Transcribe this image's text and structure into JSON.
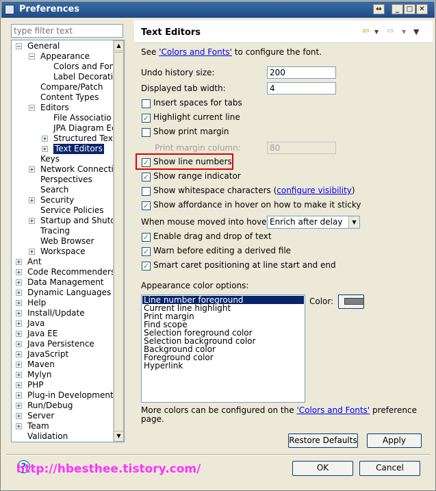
{
  "window": {
    "title": "Preferences"
  },
  "filter": {
    "placeholder": "type filter text"
  },
  "tree": [
    {
      "label": "General",
      "level": 0,
      "toggle": "−"
    },
    {
      "label": "Appearance",
      "level": 1,
      "toggle": "−"
    },
    {
      "label": "Colors and Font",
      "level": 2,
      "toggle": ""
    },
    {
      "label": "Label Decoratio",
      "level": 2,
      "toggle": ""
    },
    {
      "label": "Compare/Patch",
      "level": 1,
      "toggle": ""
    },
    {
      "label": "Content Types",
      "level": 1,
      "toggle": ""
    },
    {
      "label": "Editors",
      "level": 1,
      "toggle": "−"
    },
    {
      "label": "File Associatio",
      "level": 2,
      "toggle": ""
    },
    {
      "label": "JPA Diagram Ec",
      "level": 2,
      "toggle": ""
    },
    {
      "label": "Structured Text",
      "level": 2,
      "toggle": "+"
    },
    {
      "label": "Text Editors",
      "level": 2,
      "toggle": "+",
      "selected": true
    },
    {
      "label": "Keys",
      "level": 1,
      "toggle": ""
    },
    {
      "label": "Network Connectio",
      "level": 1,
      "toggle": "+"
    },
    {
      "label": "Perspectives",
      "level": 1,
      "toggle": ""
    },
    {
      "label": "Search",
      "level": 1,
      "toggle": ""
    },
    {
      "label": "Security",
      "level": 1,
      "toggle": "+"
    },
    {
      "label": "Service Policies",
      "level": 1,
      "toggle": ""
    },
    {
      "label": "Startup and Shutdo",
      "level": 1,
      "toggle": "+"
    },
    {
      "label": "Tracing",
      "level": 1,
      "toggle": ""
    },
    {
      "label": "Web Browser",
      "level": 1,
      "toggle": ""
    },
    {
      "label": "Workspace",
      "level": 1,
      "toggle": "+"
    },
    {
      "label": "Ant",
      "level": 0,
      "toggle": "+"
    },
    {
      "label": "Code Recommenders",
      "level": 0,
      "toggle": "+"
    },
    {
      "label": "Data Management",
      "level": 0,
      "toggle": "+"
    },
    {
      "label": "Dynamic Languages",
      "level": 0,
      "toggle": "+"
    },
    {
      "label": "Help",
      "level": 0,
      "toggle": "+"
    },
    {
      "label": "Install/Update",
      "level": 0,
      "toggle": "+"
    },
    {
      "label": "Java",
      "level": 0,
      "toggle": "+"
    },
    {
      "label": "Java EE",
      "level": 0,
      "toggle": "+"
    },
    {
      "label": "Java Persistence",
      "level": 0,
      "toggle": "+"
    },
    {
      "label": "JavaScript",
      "level": 0,
      "toggle": "+"
    },
    {
      "label": "Maven",
      "level": 0,
      "toggle": "+"
    },
    {
      "label": "Mylyn",
      "level": 0,
      "toggle": "+"
    },
    {
      "label": "PHP",
      "level": 0,
      "toggle": "+"
    },
    {
      "label": "Plug-in Development",
      "level": 0,
      "toggle": "+"
    },
    {
      "label": "Run/Debug",
      "level": 0,
      "toggle": "+"
    },
    {
      "label": "Server",
      "level": 0,
      "toggle": "+"
    },
    {
      "label": "Team",
      "level": 0,
      "toggle": "+"
    },
    {
      "label": "Validation",
      "level": 0,
      "toggle": ""
    }
  ],
  "page": {
    "title": "Text Editors",
    "see_prefix": "See ",
    "see_link": "'Colors and Fonts'",
    "see_suffix": " to configure the font.",
    "undo_label": "Undo history size:",
    "undo_value": "200",
    "tab_label": "Displayed tab width:",
    "tab_value": "4",
    "checkboxes": [
      {
        "label": "Insert spaces for tabs",
        "checked": false
      },
      {
        "label": "Highlight current line",
        "checked": true
      },
      {
        "label": "Show print margin",
        "checked": false
      }
    ],
    "print_margin_label": "Print margin column:",
    "print_margin_value": "80",
    "checkboxes2": [
      {
        "label": "Show line numbers",
        "checked": true
      },
      {
        "label": "Show range indicator",
        "checked": true
      },
      {
        "label": "Show whitespace characters (",
        "checked": false,
        "link": "configure visibility",
        "suffix": ")"
      },
      {
        "label": "Show affordance in hover on how to make it sticky",
        "checked": true
      }
    ],
    "hover_label": "When mouse moved into hover:",
    "hover_value": "Enrich after delay",
    "checkboxes3": [
      {
        "label": "Enable drag and drop of text",
        "checked": true
      },
      {
        "label": "Warn before editing a derived file",
        "checked": true
      },
      {
        "label": "Smart caret positioning at line start and end",
        "checked": true
      }
    ],
    "appearance_label": "Appearance color options:",
    "color_options": [
      "Line number foreground",
      "Current line highlight",
      "Print margin",
      "Find scope",
      "Selection foreground color",
      "Selection background color",
      "Background color",
      "Foreground color",
      "Hyperlink"
    ],
    "selected_color_index": 0,
    "color_label": "Color:",
    "swatch_color": "#808080",
    "more_prefix": "More colors can be configured on the ",
    "more_link": "'Colors and Fonts'",
    "more_suffix": " preference",
    "more_line2": "page.",
    "restore_label": "Restore Defaults",
    "apply_label": "Apply"
  },
  "footer": {
    "ok_label": "OK",
    "cancel_label": "Cancel",
    "watermark": "http://hbesthee.tistory.com/"
  }
}
